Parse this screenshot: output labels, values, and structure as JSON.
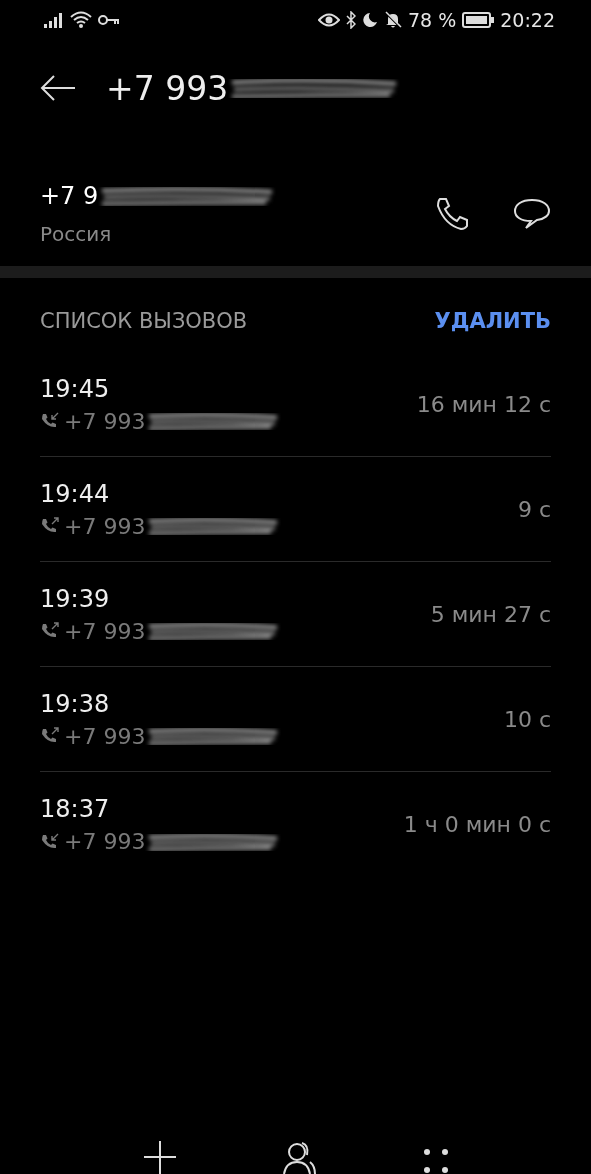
{
  "status_bar": {
    "battery": "78 %",
    "time": "20:22"
  },
  "header": {
    "title": "+7 993"
  },
  "contact": {
    "number": "+7 9",
    "region": "Россия"
  },
  "call_log": {
    "title": "СПИСОК ВЫЗОВОВ",
    "action": "УДАЛИТЬ",
    "entries": [
      {
        "time": "19:45",
        "kind": "incoming",
        "number": "+7 993",
        "duration": "16 мин 12 с"
      },
      {
        "time": "19:44",
        "kind": "outgoing",
        "number": "+7 993",
        "duration": "9 с"
      },
      {
        "time": "19:39",
        "kind": "outgoing",
        "number": "+7 993",
        "duration": "5 мин 27 с"
      },
      {
        "time": "19:38",
        "kind": "outgoing",
        "number": "+7 993",
        "duration": "10 с"
      },
      {
        "time": "18:37",
        "kind": "incoming",
        "number": "+7 993",
        "duration": "1 ч 0 мин 0 с"
      }
    ]
  }
}
